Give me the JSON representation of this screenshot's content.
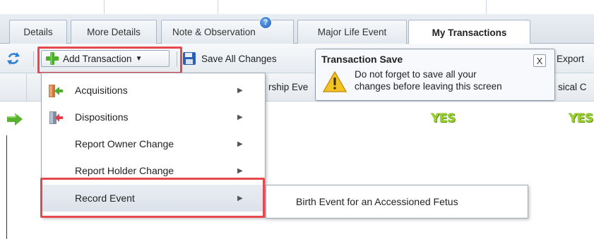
{
  "tabs": [
    {
      "label": "Details"
    },
    {
      "label": "More Details"
    },
    {
      "label": "Note & Observation",
      "badge": "?"
    },
    {
      "label": "Major Life Event"
    },
    {
      "label": "My Transactions",
      "active": true
    }
  ],
  "toolbar": {
    "add_transaction_label": "Add Transaction",
    "save_all_label": "Save All Changes",
    "export_label": "Export"
  },
  "grid": {
    "headers": [
      "rship Eve",
      "sical C"
    ],
    "row": {
      "values": [
        "YES",
        "YES"
      ]
    }
  },
  "tooltip": {
    "title": "Transaction Save",
    "message_line1": "Do not forget to save all your",
    "message_line2": "changes before leaving this screen",
    "close_label": "X"
  },
  "menu": {
    "items": [
      {
        "label": "Acquisitions",
        "icon": "acquisitions-icon"
      },
      {
        "label": "Dispositions",
        "icon": "dispositions-icon"
      },
      {
        "label": "Report Owner Change"
      },
      {
        "label": "Report Holder Change"
      },
      {
        "label": "Record Event",
        "highlighted": true
      }
    ],
    "arrow": "▶"
  },
  "submenu": {
    "items": [
      {
        "label": "Birth Event for an Accessioned Fetus"
      }
    ]
  },
  "colors": {
    "highlight_box": "#e5484d",
    "yes_green": "#9ad229",
    "add_plus_green": "#4caf2a"
  }
}
